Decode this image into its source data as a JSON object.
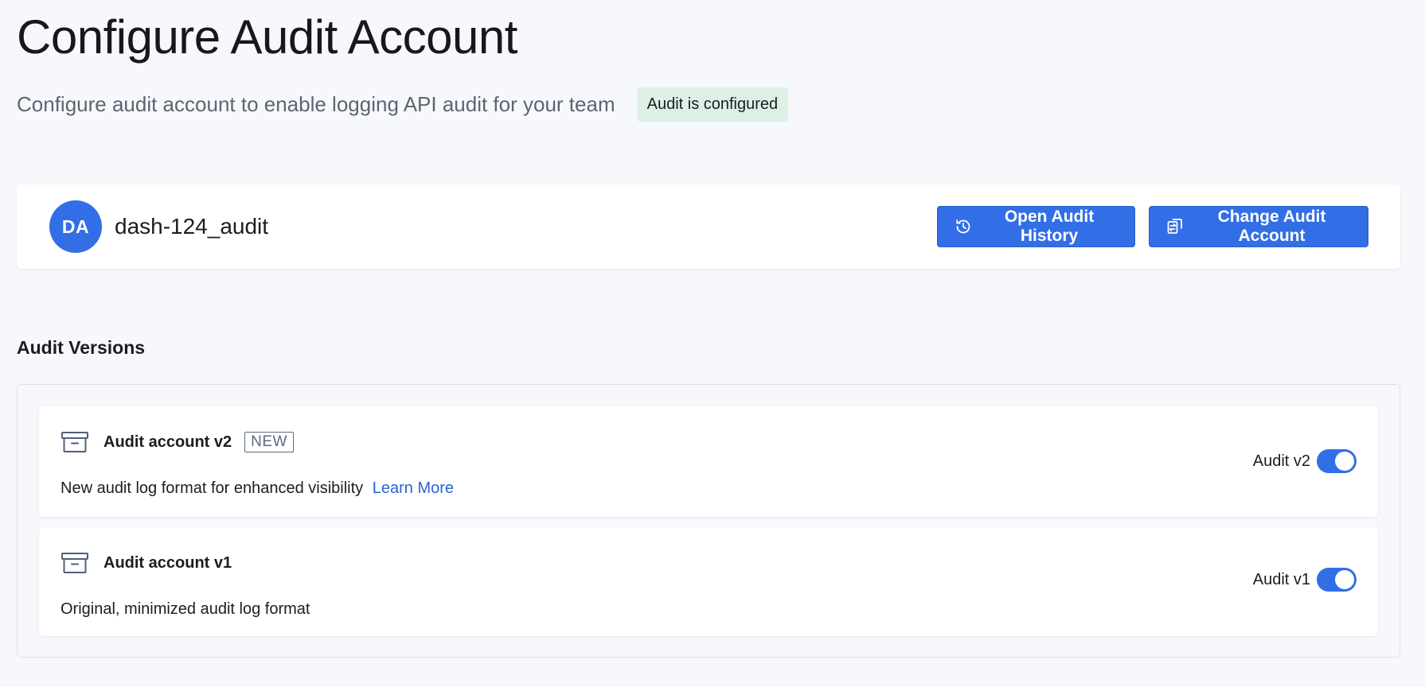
{
  "page": {
    "title": "Configure Audit Account",
    "subtitle": "Configure audit account to enable logging API audit for your team",
    "status_badge": "Audit is configured"
  },
  "account": {
    "avatar_initials": "DA",
    "name": "dash-124_audit",
    "actions": {
      "history_label": "Open Audit History",
      "history_icon": "history-icon",
      "change_label": "Change Audit Account",
      "change_icon": "swap-icon"
    }
  },
  "versions": {
    "section_title": "Audit Versions",
    "items": [
      {
        "title": "Audit account v2",
        "badge": "NEW",
        "description": "New audit log format for enhanced visibility",
        "link_label": "Learn More",
        "toggle_label": "Audit v2",
        "enabled": true,
        "icon": "archive-box-icon"
      },
      {
        "title": "Audit account v1",
        "description": "Original, minimized audit log format",
        "toggle_label": "Audit v1",
        "enabled": true,
        "icon": "archive-box-icon"
      }
    ]
  },
  "colors": {
    "accent": "#326ee6",
    "badge_bg": "#dcf0e6",
    "link": "#2b63d6",
    "background": "#f7f8fc"
  }
}
